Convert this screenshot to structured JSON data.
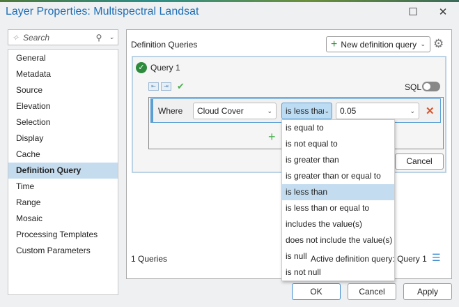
{
  "window": {
    "title": "Layer Properties: Multispectral Landsat",
    "minimize": "☐",
    "close": "✕"
  },
  "search": {
    "placeholder": "Search"
  },
  "sidebar": {
    "items": [
      {
        "label": "General"
      },
      {
        "label": "Metadata"
      },
      {
        "label": "Source"
      },
      {
        "label": "Elevation"
      },
      {
        "label": "Selection"
      },
      {
        "label": "Display"
      },
      {
        "label": "Cache"
      },
      {
        "label": "Definition Query",
        "selected": true
      },
      {
        "label": "Time"
      },
      {
        "label": "Range"
      },
      {
        "label": "Mosaic"
      },
      {
        "label": "Processing Templates"
      },
      {
        "label": "Custom Parameters"
      }
    ]
  },
  "main": {
    "heading": "Definition Queries",
    "new_query_label": "New definition query",
    "query": {
      "name": "Query 1",
      "sql_label": "SQL",
      "where_label": "Where",
      "field": "Cloud Cover",
      "operator": "is less than",
      "value": "0.05",
      "cancel_label": "Cancel"
    },
    "operator_options": [
      "is equal to",
      "is not equal to",
      "is greater than",
      "is greater than or equal to",
      "is less than",
      "is less than or equal to",
      "includes the value(s)",
      "does not include the value(s)",
      "is null",
      "is not null"
    ],
    "selected_option_index": 4,
    "footer": {
      "count": "1 Queries",
      "active": "Active definition query: Query 1"
    }
  },
  "buttons": {
    "ok": "OK",
    "cancel": "Cancel",
    "apply": "Apply"
  },
  "colors": {
    "accent": "#1f6fb5",
    "selected": "#c5dcef",
    "success": "#2e8b3e",
    "delete": "#d9552b"
  }
}
